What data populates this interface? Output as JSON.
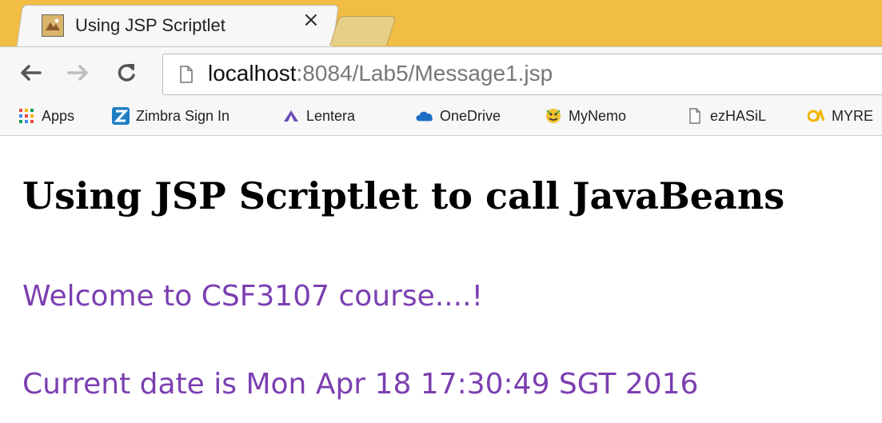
{
  "tab": {
    "title": "Using JSP Scriptlet",
    "close_glyph": "×"
  },
  "toolbar": {
    "back_icon": "arrow-left-icon",
    "forward_icon": "arrow-right-icon",
    "reload_icon": "reload-icon",
    "url_host": "localhost",
    "url_path": ":8084/Lab5/Message1.jsp"
  },
  "bookmarks": [
    {
      "label": "Apps",
      "icon": "apps-grid-icon"
    },
    {
      "label": "Zimbra Sign In",
      "icon": "zimbra-icon"
    },
    {
      "label": "Lentera",
      "icon": "lentera-icon"
    },
    {
      "label": "OneDrive",
      "icon": "onedrive-icon"
    },
    {
      "label": "MyNemo",
      "icon": "mynemo-icon"
    },
    {
      "label": "ezHASiL",
      "icon": "page-icon"
    },
    {
      "label": "MYRE",
      "icon": "myre-icon"
    }
  ],
  "page": {
    "heading": "Using JSP Scriptlet to call JavaBeans",
    "welcome": "Welcome to CSF3107 course....!",
    "date_line": "Current date is Mon Apr 18 17:30:49 SGT 2016"
  },
  "colors": {
    "tabstrip": "#f2bd45",
    "purple_text": "#7b3fb1"
  }
}
